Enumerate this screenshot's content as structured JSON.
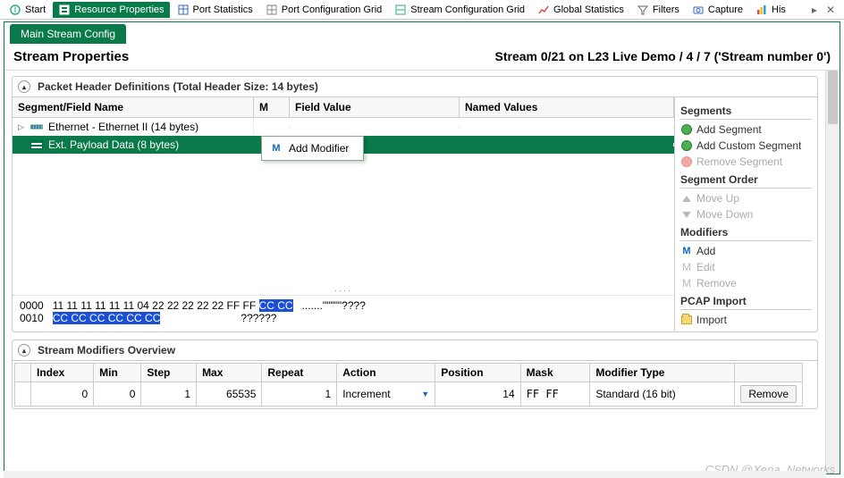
{
  "top_tabs": {
    "start": "Start",
    "resource_properties": "Resource Properties",
    "port_statistics": "Port Statistics",
    "port_config_grid": "Port Configuration Grid",
    "stream_config_grid": "Stream Configuration Grid",
    "global_stats": "Global Statistics",
    "filters": "Filters",
    "capture": "Capture",
    "his": "His"
  },
  "sub_tab": "Main Stream Config",
  "title_left": "Stream Properties",
  "title_right": "Stream 0/21 on L23 Live Demo / 4 / 7 ('Stream number 0')",
  "packet_header_panel": "Packet Header Definitions (Total Header Size: 14 bytes)",
  "grid_headers": {
    "segment": "Segment/Field Name",
    "m": "M",
    "field_value": "Field Value",
    "named_values": "Named Values"
  },
  "rows": {
    "ethernet": "Ethernet - Ethernet II (14 bytes)",
    "payload": "Ext. Payload Data (8 bytes)"
  },
  "context_menu": {
    "add_modifier": "Add Modifier"
  },
  "hex": {
    "r0_addr": "0000",
    "r0_a": "11 11 11 11 11 11 04 22 22 22 22 22 FF FF ",
    "r0_hl": "CC CC",
    "r0_ascii": "   .......\"\"\"\"\"????",
    "r1_addr": "0010",
    "r1_hl": "CC CC CC CC CC CC",
    "r1_ascii": "                           ??????"
  },
  "side": {
    "segments_hdr": "Segments",
    "add_segment": "Add Segment",
    "add_custom": "Add Custom Segment",
    "remove_segment": "Remove Segment",
    "order_hdr": "Segment Order",
    "move_up": "Move Up",
    "move_down": "Move Down",
    "modifiers_hdr": "Modifiers",
    "m_add": "Add",
    "m_edit": "Edit",
    "m_remove": "Remove",
    "pcap_hdr": "PCAP Import",
    "import": "Import"
  },
  "mod_panel": "Stream Modifiers Overview",
  "mod_cols": {
    "index": "Index",
    "min": "Min",
    "step": "Step",
    "max": "Max",
    "repeat": "Repeat",
    "action": "Action",
    "position": "Position",
    "mask": "Mask",
    "mtype": "Modifier Type"
  },
  "mod_row": {
    "index": "0",
    "min": "0",
    "step": "1",
    "max": "65535",
    "repeat": "1",
    "action": "Increment",
    "position": "14",
    "mask": "FF FF",
    "mtype": "Standard (16 bit)",
    "remove": "Remove"
  },
  "watermark": "CSDN @Xena_Networks"
}
